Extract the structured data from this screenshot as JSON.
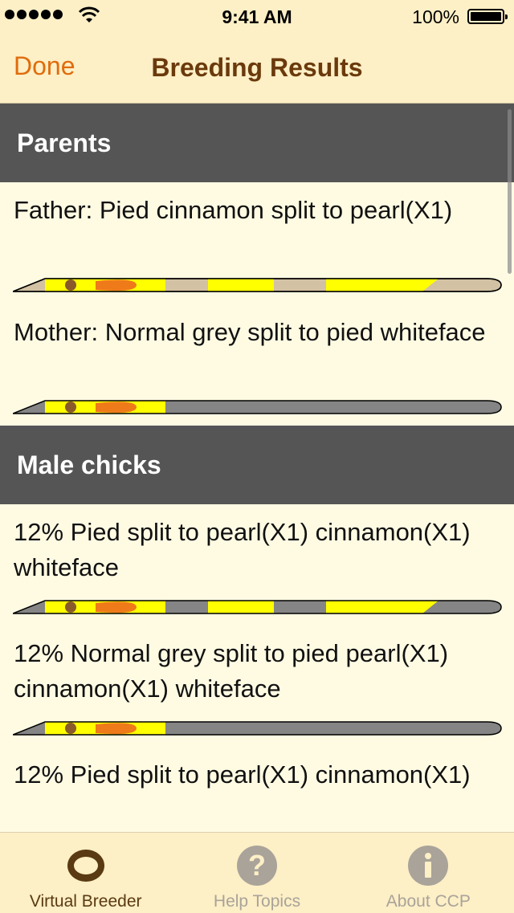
{
  "status_bar": {
    "time": "9:41 AM",
    "battery": "100%"
  },
  "nav": {
    "done_label": "Done",
    "title": "Breeding Results"
  },
  "sections": [
    {
      "header": "Parents",
      "items": [
        {
          "label": "Father: Pied cinnamon split to pearl(X1)",
          "colors": {
            "base": "#d2c1a3",
            "body": "#ffff00"
          }
        },
        {
          "label": "Mother: Normal grey split to pied whiteface",
          "colors": {
            "base": "#858585",
            "body": "#ffff00"
          }
        }
      ]
    },
    {
      "header": "Male chicks",
      "items": [
        {
          "label": "12% Pied split to pearl(X1) cinnamon(X1) whiteface",
          "colors": {
            "base": "#858585",
            "body": "#ffff00"
          }
        },
        {
          "label": "12% Normal grey split to pied pearl(X1) cinnamon(X1) whiteface",
          "colors": {
            "base": "#858585",
            "body": "#ffff00"
          }
        },
        {
          "label": "12% Pied split to pearl(X1) cinnamon(X1)",
          "colors": {
            "base": "#858585",
            "body": "#ffff00"
          }
        }
      ]
    }
  ],
  "tabs": [
    {
      "label": "Virtual Breeder",
      "icon": "ring-icon",
      "active": true
    },
    {
      "label": "Help Topics",
      "icon": "question-icon",
      "active": false
    },
    {
      "label": "About CCP",
      "icon": "info-icon",
      "active": false
    }
  ],
  "colors": {
    "accent": "#e06c0d",
    "title": "#6a3a0c",
    "section_bg": "#555555",
    "list_bg": "#fffbe3",
    "bar_bg": "#fdefc6"
  }
}
